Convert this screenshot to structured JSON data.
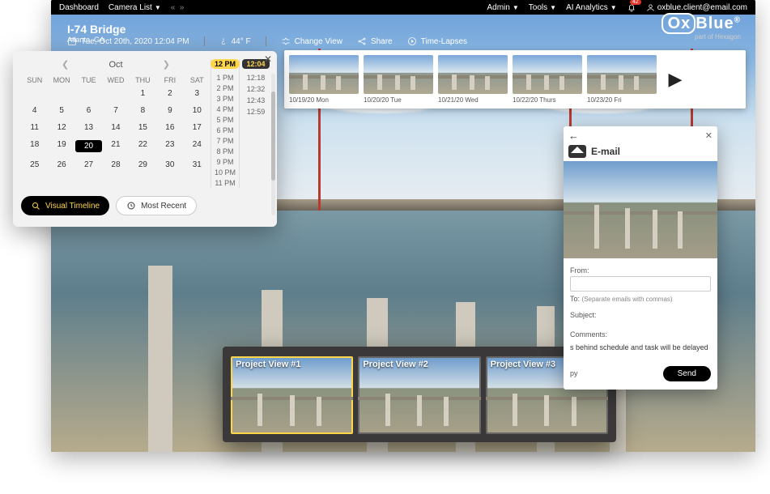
{
  "topnav": {
    "left": {
      "dashboard": "Dashboard",
      "camera_list": "Camera List"
    },
    "right": {
      "admin": "Admin",
      "tools": "Tools",
      "ai": "AI Analytics",
      "badge": "42",
      "user": "oxblue.client@email.com"
    }
  },
  "project": {
    "title": "I-74 Bridge",
    "location": "Atlanta, GA"
  },
  "toolbar": {
    "datetime": "Tue, Oct 20th, 2020 12:04 PM",
    "temp": "44° F",
    "change_view": "Change View",
    "share": "Share",
    "timelapses": "Time-Lapses"
  },
  "logo": {
    "brand": "OxBlue",
    "sub": "part of Hexagon"
  },
  "filmstrip": {
    "items": [
      {
        "label": "10/19/20 Mon"
      },
      {
        "label": "10/20/20 Tue"
      },
      {
        "label": "10/21/20 Wed"
      },
      {
        "label": "10/22/20 Thurs"
      },
      {
        "label": "10/23/20 Fri"
      }
    ]
  },
  "datepicker": {
    "month": "Oct",
    "dow": [
      "SUN",
      "MON",
      "TUE",
      "WED",
      "THU",
      "FRI",
      "SAT"
    ],
    "weeks": [
      [
        "",
        "",
        "",
        "",
        "1",
        "2",
        "3"
      ],
      [
        "4",
        "5",
        "6",
        "7",
        "8",
        "9",
        "10"
      ],
      [
        "11",
        "12",
        "13",
        "14",
        "15",
        "16",
        "17"
      ],
      [
        "18",
        "19",
        "20",
        "21",
        "22",
        "23",
        "24"
      ],
      [
        "25",
        "26",
        "27",
        "28",
        "29",
        "30",
        "31"
      ]
    ],
    "selected_day": "20",
    "hour_selected": "12 PM",
    "hours": [
      "1 PM",
      "2 PM",
      "3 PM",
      "4 PM",
      "5 PM",
      "6 PM",
      "7 PM",
      "8 PM",
      "9 PM",
      "10 PM",
      "11 PM"
    ],
    "minute_selected": "12:04",
    "minutes": [
      "12:18",
      "12:32",
      "12:43",
      "12:59"
    ],
    "btn_visual": "Visual Timeline",
    "btn_recent": "Most Recent"
  },
  "projviews": {
    "items": [
      {
        "title": "Project View #1"
      },
      {
        "title": "Project View #2"
      },
      {
        "title": "Project View #3"
      }
    ]
  },
  "email": {
    "title": "E-mail",
    "from_label": "From:",
    "from_value": "",
    "to_label": "To:",
    "to_hint": "(Separate emails with commas)",
    "subject_label": "Subject:",
    "comments_label": "Comments:",
    "body_overflow": "s behind schedule and task will be delayed",
    "copy": "py",
    "send": "Send"
  }
}
